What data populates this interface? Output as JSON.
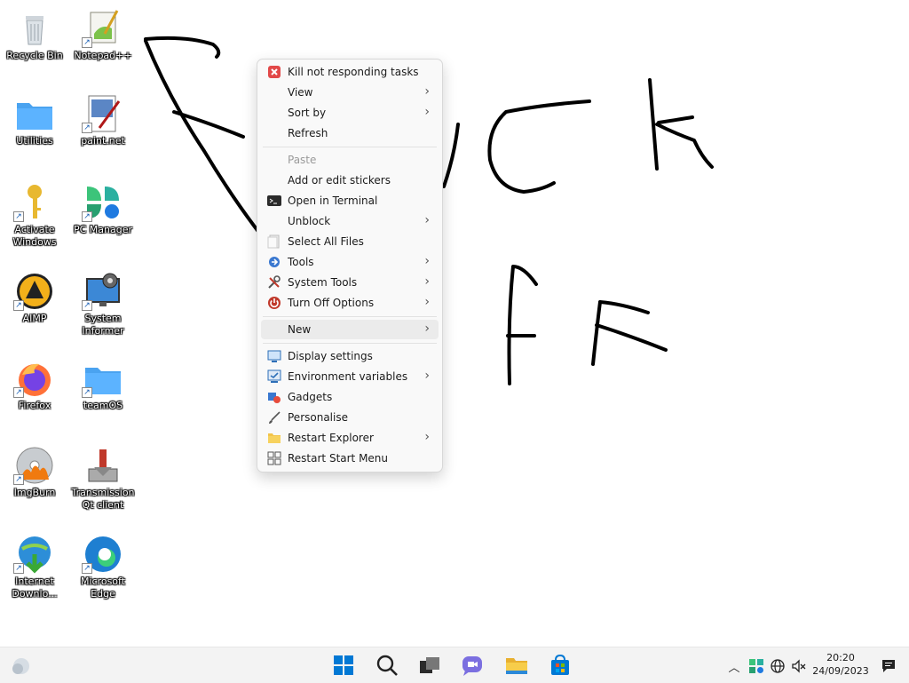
{
  "desktop_icons": [
    {
      "name": "Recycle Bin"
    },
    {
      "name": "Notepad++"
    },
    {
      "name": "Utilities"
    },
    {
      "name": "paint.net"
    },
    {
      "name": "Activate Windows"
    },
    {
      "name": "PC Manager"
    },
    {
      "name": "AIMP"
    },
    {
      "name": "System Informer"
    },
    {
      "name": "Firefox"
    },
    {
      "name": "teamOS"
    },
    {
      "name": "ImgBurn"
    },
    {
      "name": "Transmission Qt client"
    },
    {
      "name": "Internet Downlo..."
    },
    {
      "name": "Microsoft Edge"
    }
  ],
  "context_menu": {
    "items": [
      {
        "label": "Kill not responding tasks",
        "icon": "kill-tasks-icon"
      },
      {
        "label": "View",
        "submenu": true
      },
      {
        "label": "Sort by",
        "submenu": true
      },
      {
        "label": "Refresh"
      },
      {
        "label": "Paste",
        "disabled": true
      },
      {
        "label": "Add or edit stickers"
      },
      {
        "label": "Open in Terminal",
        "icon": "terminal-icon"
      },
      {
        "label": "Unblock",
        "submenu": true
      },
      {
        "label": "Select All Files",
        "icon": "select-files-icon"
      },
      {
        "label": "Tools",
        "icon": "tools-icon",
        "submenu": true
      },
      {
        "label": "System Tools",
        "icon": "system-tools-icon",
        "submenu": true
      },
      {
        "label": "Turn Off Options",
        "icon": "power-icon",
        "submenu": true
      },
      {
        "label": "New",
        "submenu": true,
        "highlighted": true
      },
      {
        "label": "Display settings",
        "icon": "display-icon"
      },
      {
        "label": "Environment variables",
        "icon": "env-vars-icon",
        "submenu": true
      },
      {
        "label": "Gadgets",
        "icon": "gadgets-icon"
      },
      {
        "label": "Personalise",
        "icon": "brush-icon"
      },
      {
        "label": "Restart Explorer",
        "icon": "folder-icon",
        "submenu": true
      },
      {
        "label": "Restart Start Menu",
        "icon": "start-grid-icon"
      }
    ]
  },
  "taskbar": {
    "apps": [
      "start-icon",
      "search-icon",
      "task-view-icon",
      "chat-icon",
      "file-explorer-icon",
      "store-icon"
    ],
    "clock": {
      "time": "20:20",
      "date": "24/09/2023"
    }
  },
  "colors": {
    "accent": "#0067c0",
    "menu_bg": "#f9f9f9",
    "taskbar_bg": "#f3f3f3"
  }
}
